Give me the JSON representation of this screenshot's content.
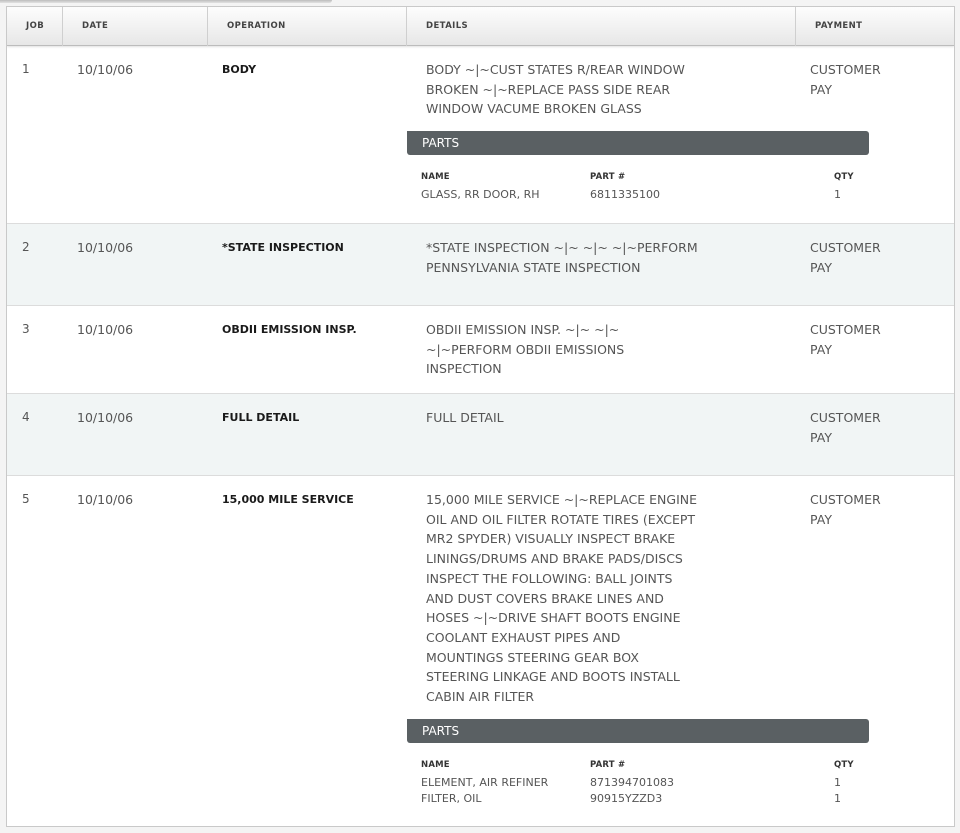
{
  "columns": {
    "job": "JOB",
    "date": "DATE",
    "operation": "OPERATION",
    "details": "DETAILS",
    "payment": "PAYMENT"
  },
  "parts_labels": {
    "title": "PARTS",
    "name": "NAME",
    "part_number": "PART #",
    "qty": "QTY"
  },
  "jobs": [
    {
      "job": "1",
      "date": "10/10/06",
      "operation": "BODY",
      "details": [
        "BODY ~|~CUST STATES R/REAR WINDOW",
        "BROKEN ~|~REPLACE PASS SIDE REAR",
        "WINDOW VACUME BROKEN GLASS"
      ],
      "payment": [
        "CUSTOMER",
        "PAY"
      ],
      "parts": [
        {
          "name": "GLASS, RR DOOR, RH",
          "part_number": "6811335100",
          "qty": "1"
        }
      ]
    },
    {
      "job": "2",
      "date": "10/10/06",
      "operation": "*STATE INSPECTION",
      "details": [
        "*STATE INSPECTION ~|~ ~|~ ~|~PERFORM",
        "PENNSYLVANIA STATE INSPECTION"
      ],
      "payment": [
        "CUSTOMER",
        "PAY"
      ],
      "parts": []
    },
    {
      "job": "3",
      "date": "10/10/06",
      "operation": "OBDII EMISSION INSP.",
      "details": [
        "OBDII EMISSION INSP. ~|~ ~|~",
        "~|~PERFORM OBDII EMISSIONS",
        "INSPECTION"
      ],
      "payment": [
        "CUSTOMER",
        "PAY"
      ],
      "parts": []
    },
    {
      "job": "4",
      "date": "10/10/06",
      "operation": "FULL DETAIL",
      "details": [
        "FULL DETAIL"
      ],
      "payment": [
        "CUSTOMER",
        "PAY"
      ],
      "parts": []
    },
    {
      "job": "5",
      "date": "10/10/06",
      "operation": "15,000 MILE SERVICE",
      "details": [
        "15,000 MILE SERVICE ~|~REPLACE ENGINE",
        "OIL AND OIL FILTER ROTATE TIRES (EXCEPT",
        "MR2 SPYDER) VISUALLY INSPECT BRAKE",
        "LININGS/DRUMS AND BRAKE PADS/DISCS",
        "INSPECT THE FOLLOWING: BALL JOINTS",
        "AND DUST COVERS BRAKE LINES AND",
        "HOSES ~|~DRIVE SHAFT BOOTS ENGINE",
        "COOLANT EXHAUST PIPES AND",
        "MOUNTINGS STEERING GEAR BOX",
        "STEERING LINKAGE AND BOOTS INSTALL",
        "CABIN AIR FILTER"
      ],
      "payment": [
        "CUSTOMER",
        "PAY"
      ],
      "parts": [
        {
          "name": "ELEMENT, AIR REFINER",
          "part_number": "871394701083",
          "qty": "1"
        },
        {
          "name": "FILTER, OIL",
          "part_number": "90915YZZD3",
          "qty": "1"
        }
      ]
    }
  ]
}
